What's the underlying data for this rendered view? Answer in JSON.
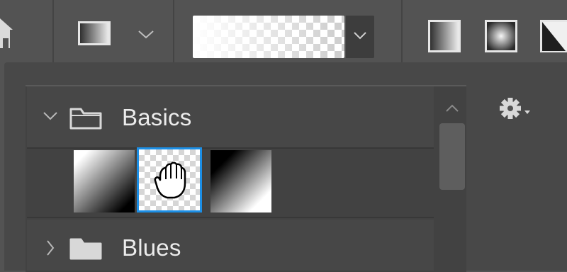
{
  "toolbar": {
    "home": {
      "icon": "home-icon"
    },
    "tool_preset": {
      "icon": "gradient-tool-icon",
      "dropdown_icon": "chevron-down-icon"
    },
    "gradient_picker": {
      "preview": "white-to-transparent",
      "dropdown_icon": "chevron-down-icon"
    },
    "gradient_styles": [
      {
        "name": "linear-gradient-icon"
      },
      {
        "name": "radial-gradient-icon"
      },
      {
        "name": "angle-gradient-icon"
      }
    ]
  },
  "panel": {
    "settings_icon": "gear-icon",
    "groups": [
      {
        "label": "Basics",
        "expanded": true,
        "icon": "folder-icon"
      },
      {
        "label": "Blues",
        "expanded": false,
        "icon": "folder-icon"
      }
    ],
    "basics_presets": [
      {
        "name": "foreground-to-background",
        "selected": false
      },
      {
        "name": "foreground-to-transparent",
        "selected": true
      },
      {
        "name": "black-white",
        "selected": false
      }
    ],
    "cursor": "grab-hand-icon"
  },
  "colors": {
    "background": "#535353",
    "panel": "#424242",
    "selection": "#1c8fe6",
    "text": "#ececec"
  }
}
